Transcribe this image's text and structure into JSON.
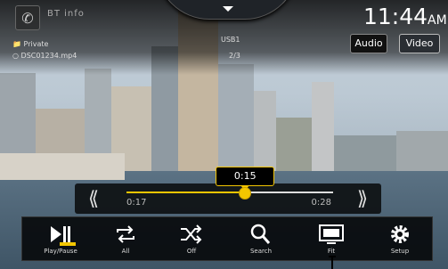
{
  "status": {
    "phone_icon": "phone-icon",
    "bt_text": "BT info",
    "clock_time": "11:44",
    "clock_ampm": "AM"
  },
  "media": {
    "folder": "Private",
    "filename": "DSC01234.mp4",
    "source": "USB1",
    "track": "2/3"
  },
  "tabs": [
    {
      "label": "Audio",
      "active": false
    },
    {
      "label": "Video",
      "active": true
    }
  ],
  "seek": {
    "popup_time": "0:15",
    "elapsed": "0:17",
    "total": "0:28",
    "progress": 0.57
  },
  "toolbar": [
    {
      "label": "Play/Pause",
      "icon": "play-pause-icon"
    },
    {
      "label": "All",
      "icon": "repeat-icon"
    },
    {
      "label": "Off",
      "icon": "shuffle-icon"
    },
    {
      "label": "Search",
      "icon": "search-icon"
    },
    {
      "label": "Fit",
      "icon": "screen-fit-icon"
    },
    {
      "label": "Setup",
      "icon": "gear-icon"
    }
  ],
  "colors": {
    "accent": "#f3c600"
  }
}
